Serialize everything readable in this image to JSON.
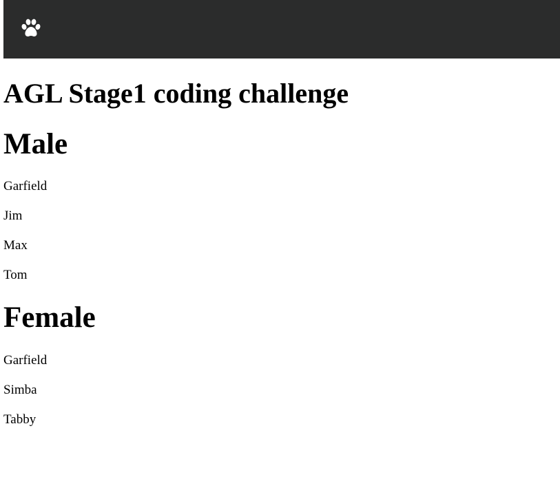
{
  "navbar": {
    "brand_icon": "paw-icon",
    "background_color": "#2b2c2c",
    "icon_color": "#ffffff"
  },
  "page": {
    "title": "AGL Stage1 coding challenge"
  },
  "groups": [
    {
      "heading": "Male",
      "names": [
        "Garfield",
        "Jim",
        "Max",
        "Tom"
      ]
    },
    {
      "heading": "Female",
      "names": [
        "Garfield",
        "Simba",
        "Tabby"
      ]
    }
  ]
}
